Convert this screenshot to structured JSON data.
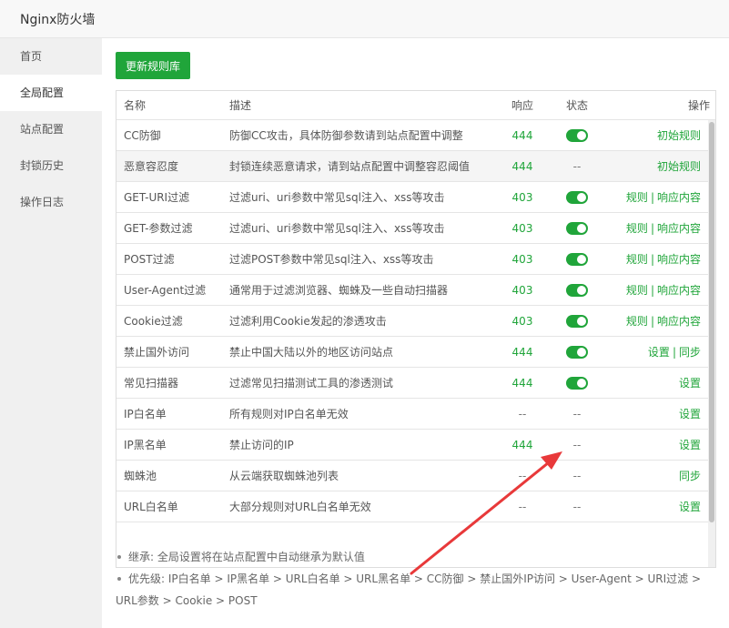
{
  "window": {
    "title": "Nginx防火墙"
  },
  "sidebar": {
    "items": [
      {
        "label": "首页"
      },
      {
        "label": "全局配置"
      },
      {
        "label": "站点配置"
      },
      {
        "label": "封锁历史"
      },
      {
        "label": "操作日志"
      }
    ],
    "active_index": 1
  },
  "toolbar": {
    "update_label": "更新规则库"
  },
  "table": {
    "headers": {
      "name": "名称",
      "desc": "描述",
      "response": "响应",
      "status": "状态",
      "ops": "操作"
    },
    "rows": [
      {
        "name": "CC防御",
        "desc": "防御CC攻击，具体防御参数请到站点配置中调整",
        "response": "444",
        "status": "on",
        "ops": [
          "初始规则"
        ]
      },
      {
        "name": "恶意容忍度",
        "desc": "封锁连续恶意请求，请到站点配置中调整容忍阈值",
        "response": "444",
        "status": "--",
        "ops": [
          "初始规则"
        ]
      },
      {
        "name": "GET-URI过滤",
        "desc": "过滤uri、uri参数中常见sql注入、xss等攻击",
        "response": "403",
        "status": "on",
        "ops": [
          "规则",
          "响应内容"
        ]
      },
      {
        "name": "GET-参数过滤",
        "desc": "过滤uri、uri参数中常见sql注入、xss等攻击",
        "response": "403",
        "status": "on",
        "ops": [
          "规则",
          "响应内容"
        ]
      },
      {
        "name": "POST过滤",
        "desc": "过滤POST参数中常见sql注入、xss等攻击",
        "response": "403",
        "status": "on",
        "ops": [
          "规则",
          "响应内容"
        ]
      },
      {
        "name": "User-Agent过滤",
        "desc": "通常用于过滤浏览器、蜘蛛及一些自动扫描器",
        "response": "403",
        "status": "on",
        "ops": [
          "规则",
          "响应内容"
        ]
      },
      {
        "name": "Cookie过滤",
        "desc": "过滤利用Cookie发起的渗透攻击",
        "response": "403",
        "status": "on",
        "ops": [
          "规则",
          "响应内容"
        ]
      },
      {
        "name": "禁止国外访问",
        "desc": "禁止中国大陆以外的地区访问站点",
        "response": "444",
        "status": "on",
        "ops": [
          "设置",
          "同步"
        ]
      },
      {
        "name": "常见扫描器",
        "desc": "过滤常见扫描测试工具的渗透测试",
        "response": "444",
        "status": "on",
        "ops": [
          "设置"
        ]
      },
      {
        "name": "IP白名单",
        "desc": "所有规则对IP白名单无效",
        "response": "--",
        "status": "--",
        "ops": [
          "设置"
        ]
      },
      {
        "name": "IP黑名单",
        "desc": "禁止访问的IP",
        "response": "444",
        "status": "--",
        "ops": [
          "设置"
        ]
      },
      {
        "name": "蜘蛛池",
        "desc": "从云端获取蜘蛛池列表",
        "response": "--",
        "status": "--",
        "ops": [
          "同步"
        ]
      },
      {
        "name": "URL白名单",
        "desc": "大部分规则对URL白名单无效",
        "response": "--",
        "status": "--",
        "ops": [
          "设置"
        ]
      }
    ]
  },
  "notes": [
    "继承: 全局设置将在站点配置中自动继承为默认值",
    "优先级: IP白名单 > IP黑名单 > URL白名单 > URL黑名单 > CC防御 > 禁止国外IP访问 > User-Agent > URI过滤 > URL参数 > Cookie > POST"
  ],
  "colors": {
    "accent": "#20a53a",
    "annotation_arrow": "#e8393a"
  }
}
